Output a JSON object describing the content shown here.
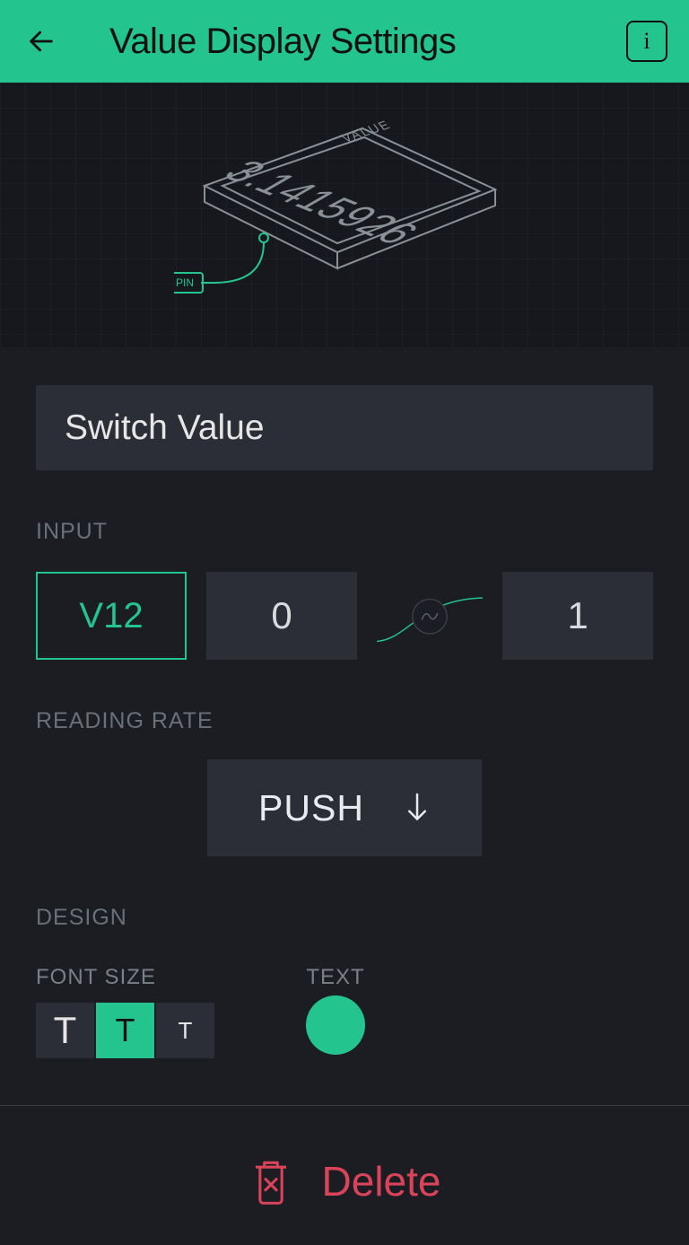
{
  "header": {
    "title": "Value Display Settings"
  },
  "preview": {
    "value_label": "VALUE",
    "value": "3.1415926",
    "pin_label": "PIN"
  },
  "name_field": "Switch Value",
  "input": {
    "section_label": "INPUT",
    "pin": "V12",
    "min": "0",
    "max": "1"
  },
  "reading_rate": {
    "section_label": "READING RATE",
    "value": "PUSH"
  },
  "design": {
    "section_label": "DESIGN",
    "font_size_label": "FONT SIZE",
    "text_label": "TEXT",
    "font_selected": "medium",
    "text_color": "#24c48e"
  },
  "delete": {
    "label": "Delete"
  }
}
